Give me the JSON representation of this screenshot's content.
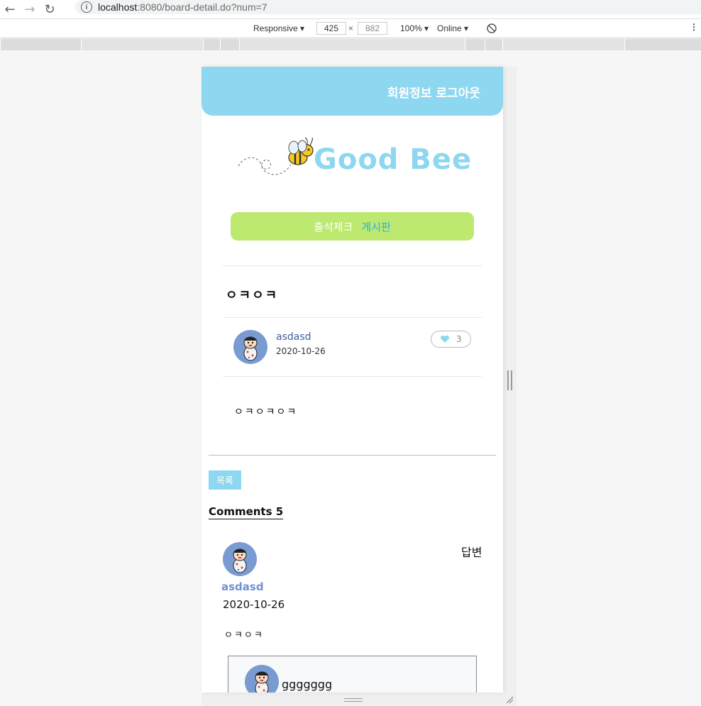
{
  "browser": {
    "url_host": "localhost",
    "url_rest": ":8080/board-detail.do?num=7"
  },
  "devtools": {
    "device": "Responsive",
    "width": "425",
    "height": "882",
    "zoom": "100%",
    "network": "Online"
  },
  "header": {
    "member_info": "회원정보",
    "logout": "로그아웃"
  },
  "logo": {
    "text": "Good Bee"
  },
  "nav": {
    "attendance": "출석체크",
    "board": "게시판"
  },
  "post": {
    "title": "ㅇㅋㅇㅋ",
    "author": "asdasd",
    "date": "2020-10-26",
    "likes": "3",
    "content": "ㅇㅋㅇㅋㅇㅋ"
  },
  "actions": {
    "list_label": "목록"
  },
  "comments": {
    "title": "Comments 5",
    "items": [
      {
        "author": "asdasd",
        "date": "2020-10-26",
        "text": "ㅇㅋㅇㅋ",
        "reply_label": "답변"
      }
    ],
    "reply_preview": "ggggggg"
  },
  "colors": {
    "header": "#8dd7f0",
    "nav_pill": "#bde970",
    "avatar_bg": "#7a9bd1"
  }
}
